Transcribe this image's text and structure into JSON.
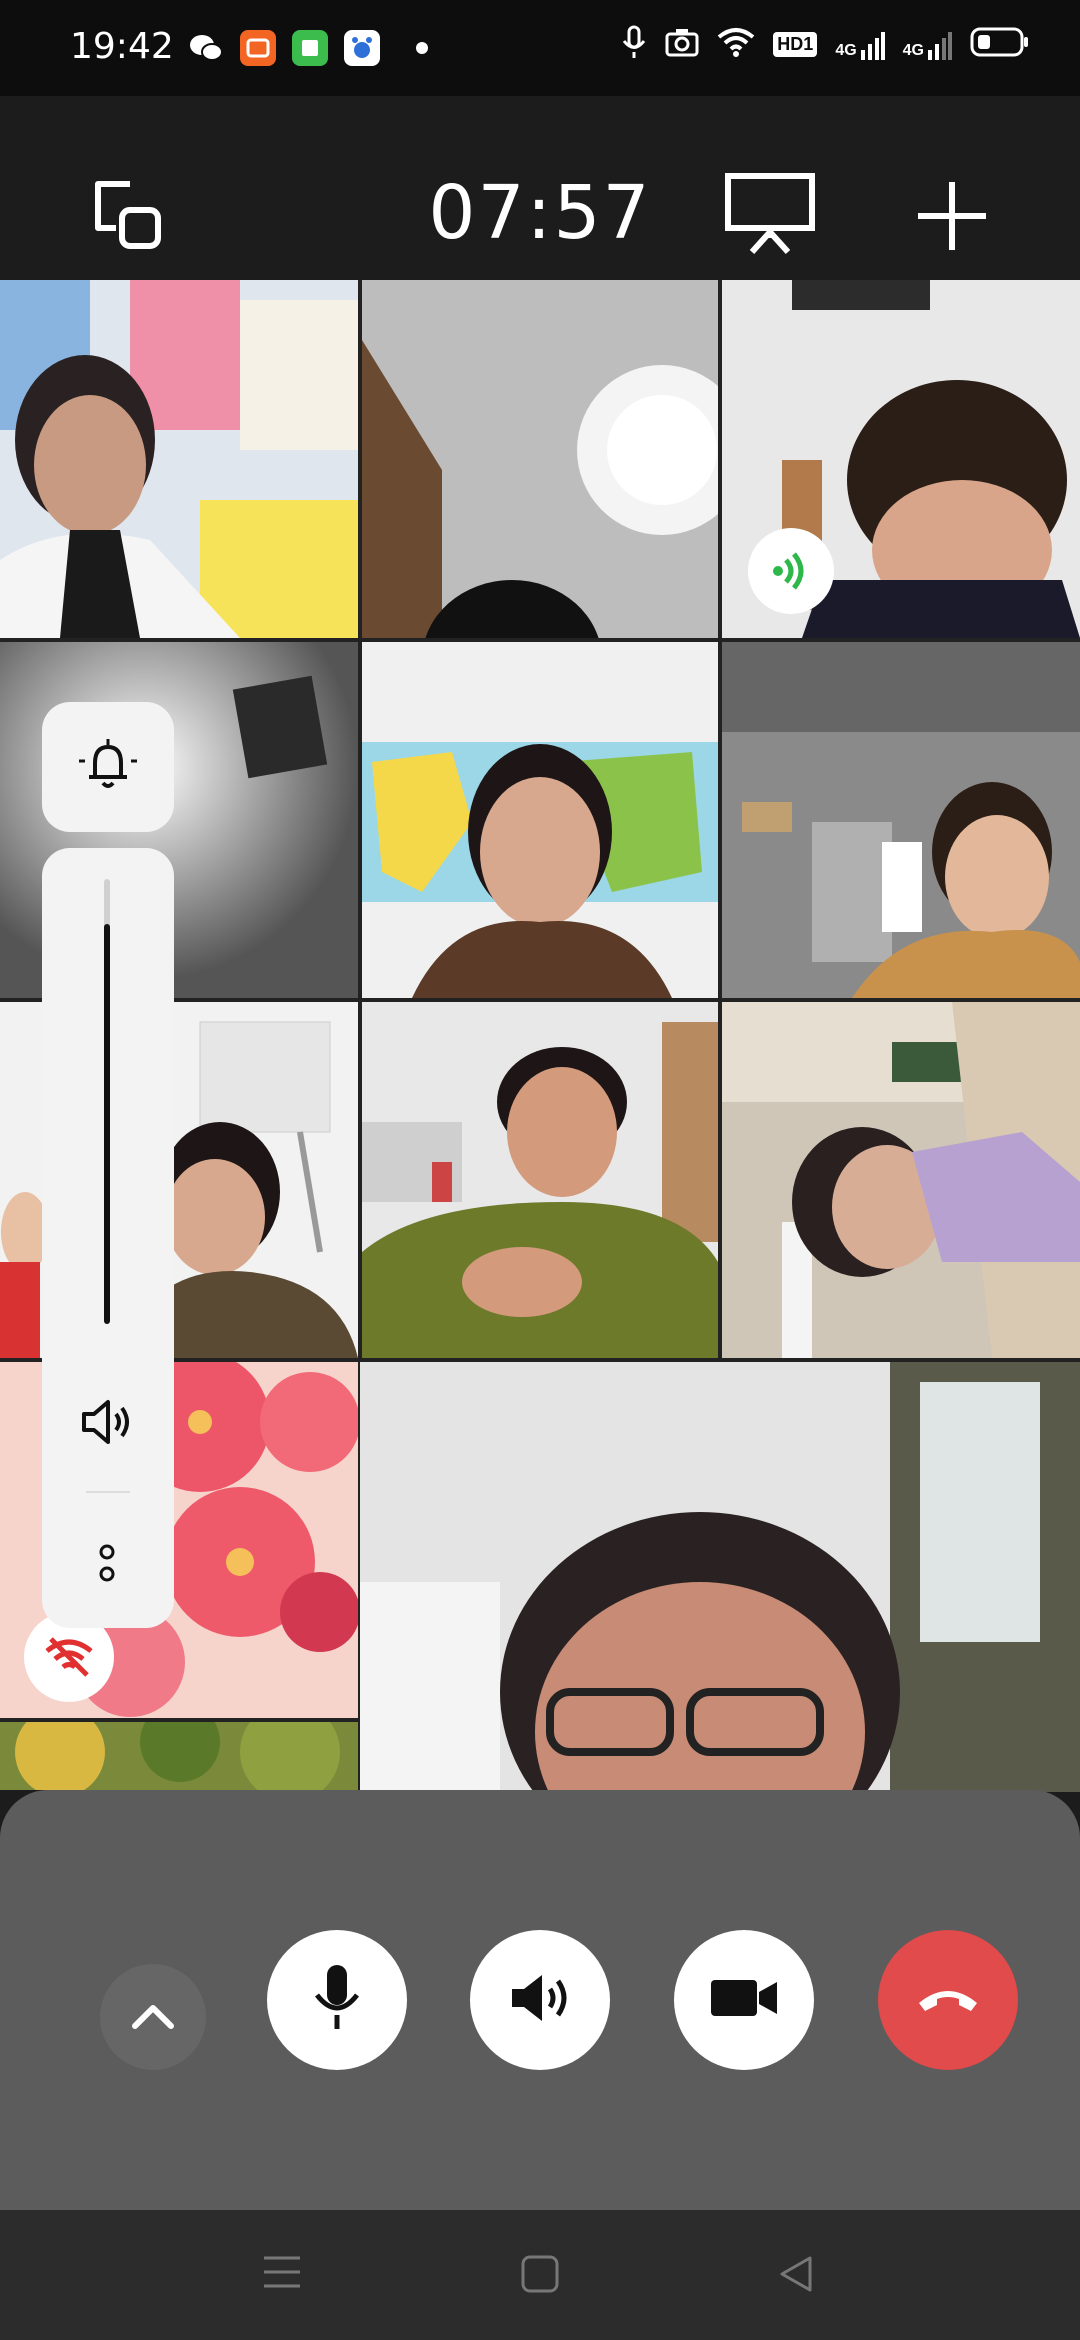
{
  "status_bar": {
    "time": "19:42",
    "network_badges": [
      "HD1",
      "4G",
      "4G"
    ],
    "app_icons": [
      "wechat-icon",
      "video-app-icon",
      "green-app-icon",
      "baidu-icon"
    ]
  },
  "call": {
    "timer": "07:57"
  },
  "toolbar": {
    "icons": [
      "minimize-window-icon",
      "screen-share-icon",
      "add-participant-icon"
    ]
  },
  "participants": [
    {
      "name": "participant-1",
      "speaking": false
    },
    {
      "name": "participant-2",
      "speaking": false
    },
    {
      "name": "participant-3",
      "speaking": true
    },
    {
      "name": "participant-4",
      "speaking": false
    },
    {
      "name": "participant-5",
      "speaking": false
    },
    {
      "name": "participant-6",
      "speaking": false
    },
    {
      "name": "participant-7",
      "speaking": false
    },
    {
      "name": "participant-8",
      "speaking": false
    },
    {
      "name": "participant-9",
      "speaking": false
    },
    {
      "name": "participant-10",
      "muted_network": true
    },
    {
      "name": "participant-11",
      "speaking": false
    },
    {
      "name": "self-view",
      "speaking": false
    }
  ],
  "volume_panel": {
    "level": 0.9
  },
  "controls": {
    "buttons": [
      "expand",
      "microphone",
      "speaker",
      "camera",
      "hang-up"
    ]
  },
  "colors": {
    "hangup": "#e14b4b",
    "speaking": "#2fb84a",
    "network_warning": "#e03030",
    "panel": "#5c5c5c",
    "background": "#1c1c1c"
  }
}
